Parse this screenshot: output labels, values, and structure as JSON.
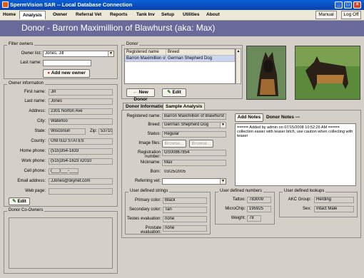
{
  "window": {
    "title": "SpermVision SAR -- Local Database Connection"
  },
  "menu": {
    "items": [
      "Home",
      "Analysis",
      "Owner",
      "Referral Vet",
      "Reports",
      "Tank Inv",
      "Setup",
      "Utilities",
      "About"
    ],
    "active": "Analysis",
    "manual": "Manual",
    "logoff": "Log Off"
  },
  "header": {
    "title": "Donor - Barron Maximillion of Blawhurst (aka: Max)"
  },
  "filter_owners": {
    "group_label": "Filter owners",
    "owner_list_label": "Owner list:",
    "owner_list_value": "Jones, Jill",
    "last_name_label": "Last name:",
    "last_name_value": "",
    "add_owner_button": "Add new owner"
  },
  "owner_info": {
    "group_label": "Owner information",
    "first_name_label": "First name:",
    "first_name": "Jill",
    "last_name_label": "Last name:",
    "last_name": "Jones",
    "address_label": "Address:",
    "address": "2301 Norton Ave",
    "city_label": "City:",
    "city": "Waterloo",
    "state_label": "State:",
    "state": "Wisconsin",
    "zip_label": "Zip:",
    "zip": "53710",
    "county_label": "County:",
    "county": "UNITED STATES",
    "home_phone_label": "Home phone:",
    "home_phone": "(515)354-1633",
    "work_phone_label": "Work phone:",
    "work_phone": "(515)354-1623 x2010",
    "cell_phone_label": "Cell phone:",
    "cell_phone": "(___)___-____",
    "email_label": "Email address:",
    "email": "JJones@skynet.com",
    "web_label": "Web page:",
    "web": "",
    "edit_button": "Edit"
  },
  "donor_coowners": {
    "group_label": "Donor Co-Owners"
  },
  "donor_grid": {
    "group_label": "Donor",
    "columns": [
      "Registered name",
      "Breed"
    ],
    "rows": [
      [
        "Barron Maximillion of Bla",
        "German Shepherd Dog"
      ]
    ],
    "new_button": "New Donor",
    "edit_button": "Edit"
  },
  "tabs": {
    "items": [
      "Donor Information",
      "Sample Analysis"
    ],
    "active": "Donor Information"
  },
  "donor_info": {
    "registered_name_label": "Registered name:",
    "registered_name": "Barron Maximillion of Blawhurst",
    "breed_label": "Breed:",
    "breed": "German Shepherd Dog",
    "status_label": "Status:",
    "status": "Regular",
    "image_files_label": "Image files:",
    "browse1": "Browse...",
    "browse2": "Browse...",
    "registration_number_label": "Registration number:",
    "registration_number": "GS00867854",
    "nickname_label": "Nickname:",
    "nickname": "Max",
    "born_label": "Born:",
    "born": "03/25/2005",
    "referring_vet_label": "Referring vet:",
    "referring_vet": ""
  },
  "notes": {
    "add_notes_button": "Add Notes",
    "title": "Donor Notes ---",
    "text": "===== Added by admin on 07/15/2008 10:52:26 AM =====\ncollection easier with teaser bitch, use caution when collecting with teaser"
  },
  "user_strings": {
    "group_label": "User defined strings",
    "primary_color_label": "Primary color:",
    "primary_color": "Black",
    "secondary_color_label": "Secondary color:",
    "secondary_color": "Tan",
    "testes_label": "Testes evaluation:",
    "testes": "none",
    "prostate_label": "Prostate evaluation:",
    "prostate": "none"
  },
  "user_numbers": {
    "group_label": "User defined numbers",
    "tattoo_label": "Tattoo:",
    "tattoo": "783009",
    "microchip_label": "MicroChip:",
    "microchip": "195925",
    "weight_label": "Weight:",
    "weight": "78"
  },
  "user_lookups": {
    "group_label": "User defined lookups",
    "akc_label": "AKC Group:",
    "akc": "Herding",
    "sex_label": "Sex:",
    "sex": "Intact Male"
  },
  "colors": {
    "header_bg": "#6a6a9a",
    "titlebar": "#0a5fd8",
    "window_bg": "#d4d0c8"
  }
}
